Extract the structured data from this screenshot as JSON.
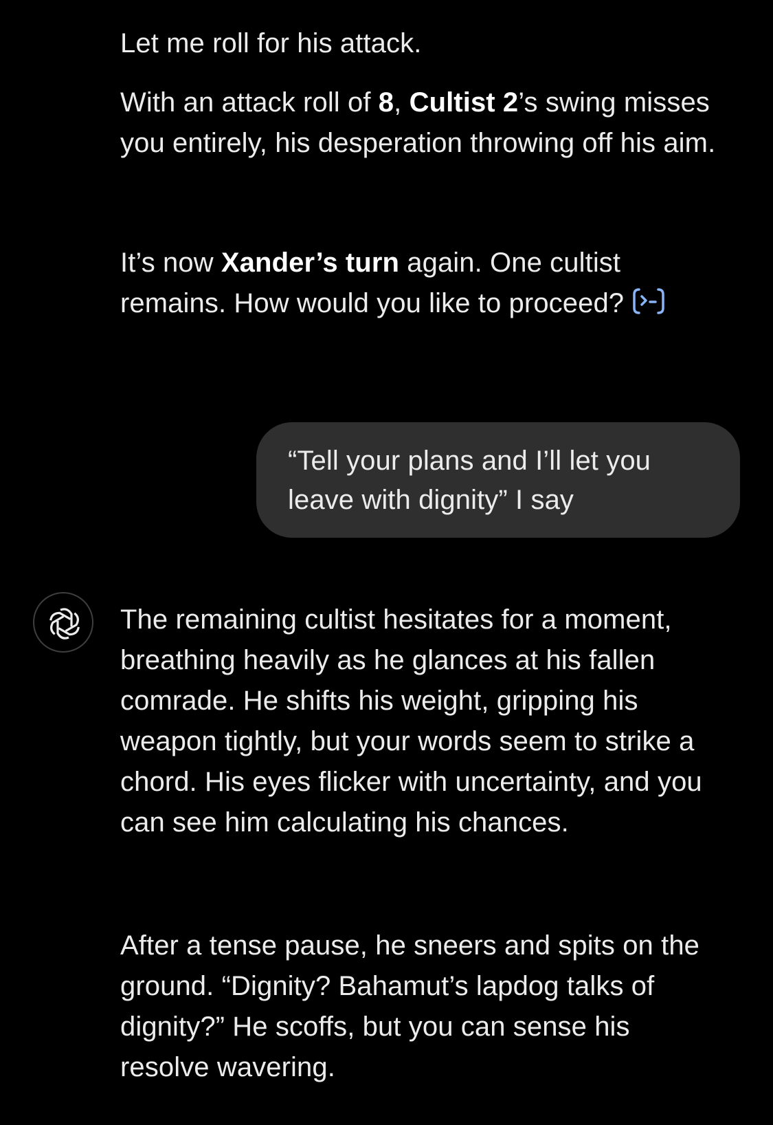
{
  "conversation": {
    "assistant_prev": {
      "line_roll": "Let me roll for his attack.",
      "attack": {
        "pre": "With an attack roll of ",
        "roll_value": "8",
        "sep": ", ",
        "enemy": "Cultist 2",
        "post": "’s swing misses you entirely, his desperation throwing off his aim."
      },
      "turn": {
        "pre": "It’s now ",
        "player_turn": "Xander’s turn",
        "post": " again. One cultist remains. How would you like to proceed?"
      },
      "tool_icon": "code-interpreter-icon"
    },
    "user_message": "“Tell your plans and I’ll let you leave with dignity” I say",
    "assistant_reply": {
      "avatar_icon": "openai-logo-icon",
      "paragraph_1": "The remaining cultist hesitates for a moment, breathing heavily as he glances at his fallen comrade. He shifts his weight, gripping his weapon tightly, but your words seem to strike a chord. His eyes flicker with uncertainty, and you can see him calculating his chances.",
      "paragraph_2": "After a tense pause, he sneers and spits on the ground. “Dignity? Bahamut’s lapdog talks of dignity?” He scoffs, but you can sense his resolve wavering."
    }
  },
  "colors": {
    "background": "#000000",
    "text": "#ececec",
    "user_bubble": "#2f2f2f",
    "tool_icon": "#8ab4f8"
  }
}
